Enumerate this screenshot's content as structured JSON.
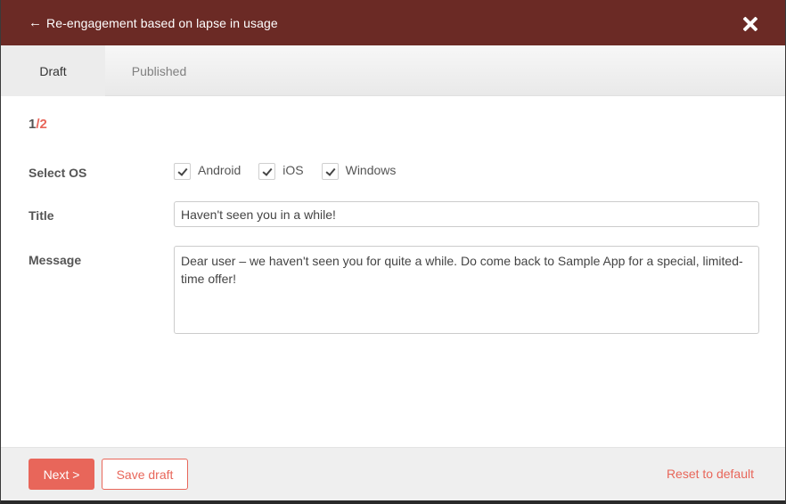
{
  "header": {
    "title": "Re-engagement based on lapse in usage",
    "back_icon": "arrow-left-icon",
    "close_icon": "close-icon",
    "color": "#6b2a25"
  },
  "tabs": [
    {
      "label": "Draft",
      "active": true
    },
    {
      "label": "Published",
      "active": false
    }
  ],
  "step": {
    "current": "1",
    "total": "/2"
  },
  "form": {
    "os_label": "Select OS",
    "os_options": [
      {
        "label": "Android",
        "checked": true
      },
      {
        "label": "iOS",
        "checked": true
      },
      {
        "label": "Windows",
        "checked": true
      }
    ],
    "title_label": "Title",
    "title_value": "Haven't seen you in a while!",
    "message_label": "Message",
    "message_value": "Dear user – we haven't seen you for quite a while. Do come back to Sample App for a special, limited-time offer!"
  },
  "footer": {
    "next_label": "Next >",
    "save_label": "Save draft",
    "reset_label": "Reset to default"
  },
  "colors": {
    "accent": "#e8665a",
    "header_bg": "#6b2a25"
  }
}
